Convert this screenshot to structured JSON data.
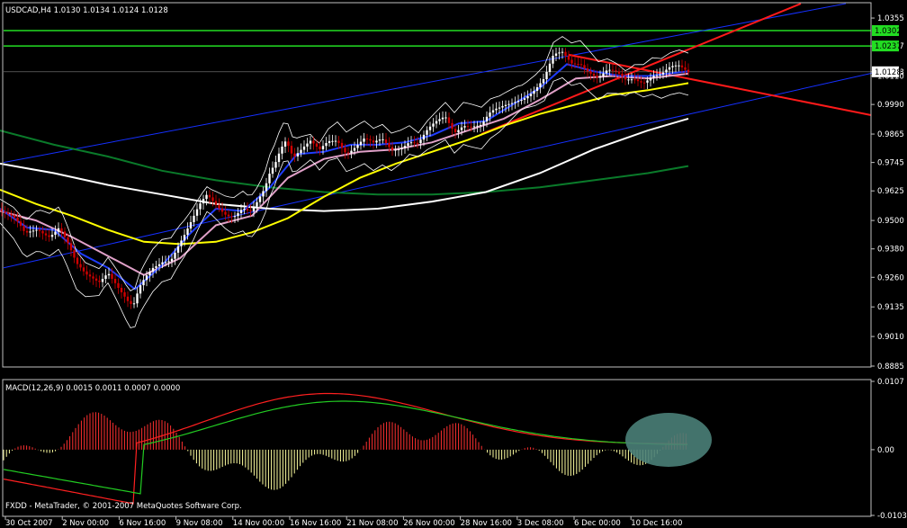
{
  "window": {
    "main_title": "USDCAD,H4  1.0130 1.0134 1.0124 1.0128",
    "sub_title": "MACD(12,26,9) 0.0015 0.0011 0.0007 0.0000",
    "copyright": "FXDD - MetaTrader, © 2001-2007 MetaQuotes Software Corp."
  },
  "colors": {
    "background": "#000000",
    "frame": "#c0c0c0",
    "bull_candle": "#d00000",
    "bear_candle": "#ffffff",
    "ma_fast": "#1e3cff",
    "ma_mid": "#e0a0c8",
    "ma_yellow": "#ffff00",
    "ma_white": "#ffffff",
    "ma_green": "#0a7a2a",
    "channel": "#1530ff",
    "trend": "#ff1a1a",
    "level": "#22dd22",
    "macd_line": "#ff2020",
    "signal_line": "#22cc22",
    "highlight": "#4a7f78"
  },
  "chart_data": [
    {
      "type": "candlestick",
      "symbol": "USDCAD",
      "timeframe": "H4",
      "ohlc_last": {
        "open": 1.013,
        "high": 1.0134,
        "low": 1.0124,
        "close": 1.0128
      },
      "ylim": [
        0.8885,
        1.0416
      ],
      "price_ticks": [
        "1.0355",
        "1.0237",
        "1.0128",
        "1.0110",
        "0.9990",
        "0.9865",
        "0.9745",
        "0.9625",
        "0.9500",
        "0.9380",
        "0.9260",
        "0.9135",
        "0.9010",
        "0.8885"
      ],
      "x_ticks": [
        "30 Oct 2007",
        "2 Nov 00:00",
        "6 Nov 16:00",
        "9 Nov 08:00",
        "14 Nov 00:00",
        "16 Nov 16:00",
        "21 Nov 08:00",
        "26 Nov 00:00",
        "28 Nov 16:00",
        "3 Dec 08:00",
        "6 Dec 00:00",
        "10 Dec 16:00"
      ],
      "horizontal_levels": [
        {
          "label": "1.0302",
          "value": 1.0302
        },
        {
          "label": "1.0237",
          "value": 1.0237
        },
        {
          "label": "1.0128",
          "value": 1.0128
        }
      ],
      "close_path": [
        [
          0,
          0.955
        ],
        [
          15,
          0.95
        ],
        [
          28,
          0.943
        ],
        [
          42,
          0.947
        ],
        [
          55,
          0.945
        ],
        [
          66,
          0.948
        ],
        [
          75,
          0.94
        ],
        [
          85,
          0.93
        ],
        [
          95,
          0.926
        ],
        [
          110,
          0.925
        ],
        [
          120,
          0.93
        ],
        [
          128,
          0.925
        ],
        [
          135,
          0.92
        ],
        [
          142,
          0.915
        ],
        [
          148,
          0.912
        ],
        [
          155,
          0.92
        ],
        [
          162,
          0.925
        ],
        [
          170,
          0.93
        ],
        [
          180,
          0.934
        ],
        [
          190,
          0.935
        ],
        [
          198,
          0.94
        ],
        [
          206,
          0.944
        ],
        [
          214,
          0.949
        ],
        [
          222,
          0.955
        ],
        [
          230,
          0.96
        ],
        [
          238,
          0.958
        ],
        [
          245,
          0.956
        ],
        [
          252,
          0.954
        ],
        [
          260,
          0.953
        ],
        [
          270,
          0.955
        ],
        [
          278,
          0.952
        ],
        [
          286,
          0.956
        ],
        [
          294,
          0.962
        ],
        [
          300,
          0.97
        ],
        [
          306,
          0.975
        ],
        [
          312,
          0.982
        ],
        [
          318,
          0.986
        ],
        [
          326,
          0.978
        ],
        [
          335,
          0.98
        ],
        [
          345,
          0.982
        ],
        [
          355,
          0.978
        ],
        [
          365,
          0.983
        ],
        [
          375,
          0.985
        ],
        [
          385,
          0.98
        ],
        [
          395,
          0.982
        ],
        [
          405,
          0.984
        ],
        [
          415,
          0.981
        ],
        [
          425,
          0.983
        ],
        [
          435,
          0.98
        ],
        [
          445,
          0.982
        ],
        [
          455,
          0.985
        ],
        [
          465,
          0.983
        ],
        [
          475,
          0.987
        ],
        [
          485,
          0.99
        ],
        [
          495,
          0.993
        ],
        [
          505,
          0.988
        ],
        [
          515,
          0.992
        ],
        [
          525,
          0.991
        ],
        [
          535,
          0.99
        ],
        [
          545,
          0.994
        ],
        [
          555,
          0.996
        ],
        [
          565,
          0.999
        ],
        [
          575,
          1.002
        ],
        [
          585,
          1.004
        ],
        [
          595,
          1.006
        ],
        [
          605,
          1.009
        ],
        [
          615,
          1.018
        ],
        [
          625,
          1.02
        ],
        [
          635,
          1.017
        ],
        [
          645,
          1.018
        ],
        [
          655,
          1.014
        ],
        [
          665,
          1.01
        ],
        [
          675,
          1.012
        ],
        [
          685,
          1.011
        ],
        [
          695,
          1.009
        ],
        [
          705,
          1.011
        ],
        [
          715,
          1.01
        ],
        [
          725,
          1.012
        ],
        [
          735,
          1.011
        ],
        [
          745,
          1.013
        ],
        [
          755,
          1.014
        ],
        [
          765,
          1.0128
        ]
      ],
      "moving_averages": [
        {
          "name": "fast",
          "points": [
            [
              0,
              0.955
            ],
            [
              30,
              0.947
            ],
            [
              60,
              0.946
            ],
            [
              90,
              0.936
            ],
            [
              120,
              0.93
            ],
            [
              150,
              0.921
            ],
            [
              180,
              0.931
            ],
            [
              210,
              0.944
            ],
            [
              240,
              0.955
            ],
            [
              270,
              0.954
            ],
            [
              300,
              0.964
            ],
            [
              330,
              0.978
            ],
            [
              360,
              0.979
            ],
            [
              390,
              0.982
            ],
            [
              420,
              0.982
            ],
            [
              450,
              0.983
            ],
            [
              480,
              0.986
            ],
            [
              510,
              0.991
            ],
            [
              540,
              0.992
            ],
            [
              570,
              0.999
            ],
            [
              600,
              1.006
            ],
            [
              630,
              1.016
            ],
            [
              660,
              1.013
            ],
            [
              690,
              1.011
            ],
            [
              720,
              1.011
            ],
            [
              765,
              1.013
            ]
          ]
        },
        {
          "name": "mid",
          "points": [
            [
              0,
              0.954
            ],
            [
              40,
              0.95
            ],
            [
              80,
              0.943
            ],
            [
              120,
              0.935
            ],
            [
              160,
              0.927
            ],
            [
              200,
              0.934
            ],
            [
              240,
              0.948
            ],
            [
              280,
              0.952
            ],
            [
              320,
              0.968
            ],
            [
              360,
              0.976
            ],
            [
              400,
              0.979
            ],
            [
              440,
              0.98
            ],
            [
              480,
              0.983
            ],
            [
              520,
              0.988
            ],
            [
              560,
              0.993
            ],
            [
              600,
              1.001
            ],
            [
              640,
              1.01
            ],
            [
              680,
              1.011
            ],
            [
              720,
              1.01
            ],
            [
              765,
              1.012
            ]
          ]
        },
        {
          "name": "yellow",
          "points": [
            [
              0,
              0.963
            ],
            [
              40,
              0.957
            ],
            [
              80,
              0.952
            ],
            [
              120,
              0.946
            ],
            [
              160,
              0.941
            ],
            [
              200,
              0.94
            ],
            [
              240,
              0.941
            ],
            [
              280,
              0.945
            ],
            [
              320,
              0.951
            ],
            [
              360,
              0.96
            ],
            [
              400,
              0.968
            ],
            [
              440,
              0.974
            ],
            [
              480,
              0.979
            ],
            [
              520,
              0.984
            ],
            [
              560,
              0.99
            ],
            [
              600,
              0.995
            ],
            [
              640,
              0.999
            ],
            [
              680,
              1.003
            ],
            [
              720,
              1.005
            ],
            [
              765,
              1.008
            ]
          ]
        },
        {
          "name": "white",
          "points": [
            [
              0,
              0.974
            ],
            [
              60,
              0.97
            ],
            [
              120,
              0.965
            ],
            [
              180,
              0.961
            ],
            [
              240,
              0.957
            ],
            [
              300,
              0.955
            ],
            [
              360,
              0.954
            ],
            [
              420,
              0.955
            ],
            [
              480,
              0.958
            ],
            [
              540,
              0.962
            ],
            [
              600,
              0.97
            ],
            [
              660,
              0.98
            ],
            [
              720,
              0.988
            ],
            [
              765,
              0.993
            ]
          ]
        },
        {
          "name": "green",
          "points": [
            [
              0,
              0.988
            ],
            [
              60,
              0.982
            ],
            [
              120,
              0.977
            ],
            [
              180,
              0.971
            ],
            [
              240,
              0.967
            ],
            [
              300,
              0.964
            ],
            [
              360,
              0.962
            ],
            [
              420,
              0.961
            ],
            [
              480,
              0.961
            ],
            [
              540,
              0.962
            ],
            [
              600,
              0.964
            ],
            [
              660,
              0.967
            ],
            [
              720,
              0.97
            ],
            [
              765,
              0.973
            ]
          ]
        }
      ]
    },
    {
      "type": "bar",
      "name": "MACD(12,26,9)",
      "ylim": [
        -0.0103,
        0.0107
      ],
      "y_ticks": [
        "0.0107",
        "0.00",
        "-0.0103"
      ],
      "values": [
        0.0015,
        0.0011,
        0.0007,
        0.0
      ]
    }
  ]
}
